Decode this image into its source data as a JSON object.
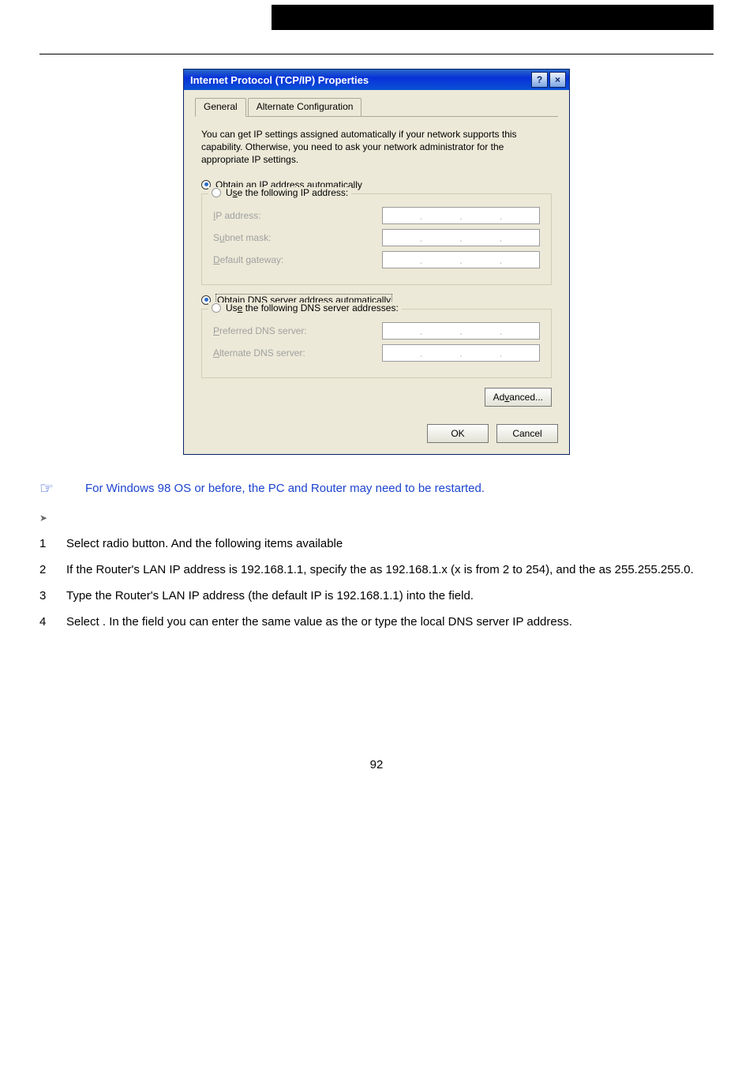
{
  "dialog": {
    "title": "Internet Protocol (TCP/IP) Properties",
    "tabs": {
      "general": "General",
      "alternate": "Alternate Configuration"
    },
    "description": "You can get IP settings assigned automatically if your network supports this capability. Otherwise, you need to ask your network administrator for the appropriate IP settings.",
    "radios": {
      "obtain_ip": "Obtain an IP address automatically",
      "use_ip": "Use the following IP address:",
      "obtain_dns": "Obtain DNS server address automatically",
      "use_dns": "Use the following DNS server addresses:"
    },
    "labels": {
      "ip_address": "IP address:",
      "subnet_mask": "Subnet mask:",
      "default_gateway": "Default gateway:",
      "preferred_dns": "Preferred DNS server:",
      "alternate_dns": "Alternate DNS server:"
    },
    "buttons": {
      "advanced": "Advanced...",
      "ok": "OK",
      "cancel": "Cancel"
    },
    "state": {
      "obtain_ip_selected": true,
      "obtain_dns_selected": true
    }
  },
  "content": {
    "note": "For Windows 98 OS or before, the PC and Router may need to be restarted.",
    "steps": {
      "s1": "Select                                      radio button. And the following items available",
      "s2": "If the Router's LAN IP address is 192.168.1.1, specify the                as 192.168.1.x (x is from 2 to 254), and the                     as 255.255.255.0.",
      "s3": "Type the Router's LAN IP address (the default IP is 192.168.1.1) into the                  field.",
      "s4": "Select                                               .    In the                            field you can enter the same value as the                     or type the local DNS server IP address."
    },
    "page_number": "92"
  }
}
